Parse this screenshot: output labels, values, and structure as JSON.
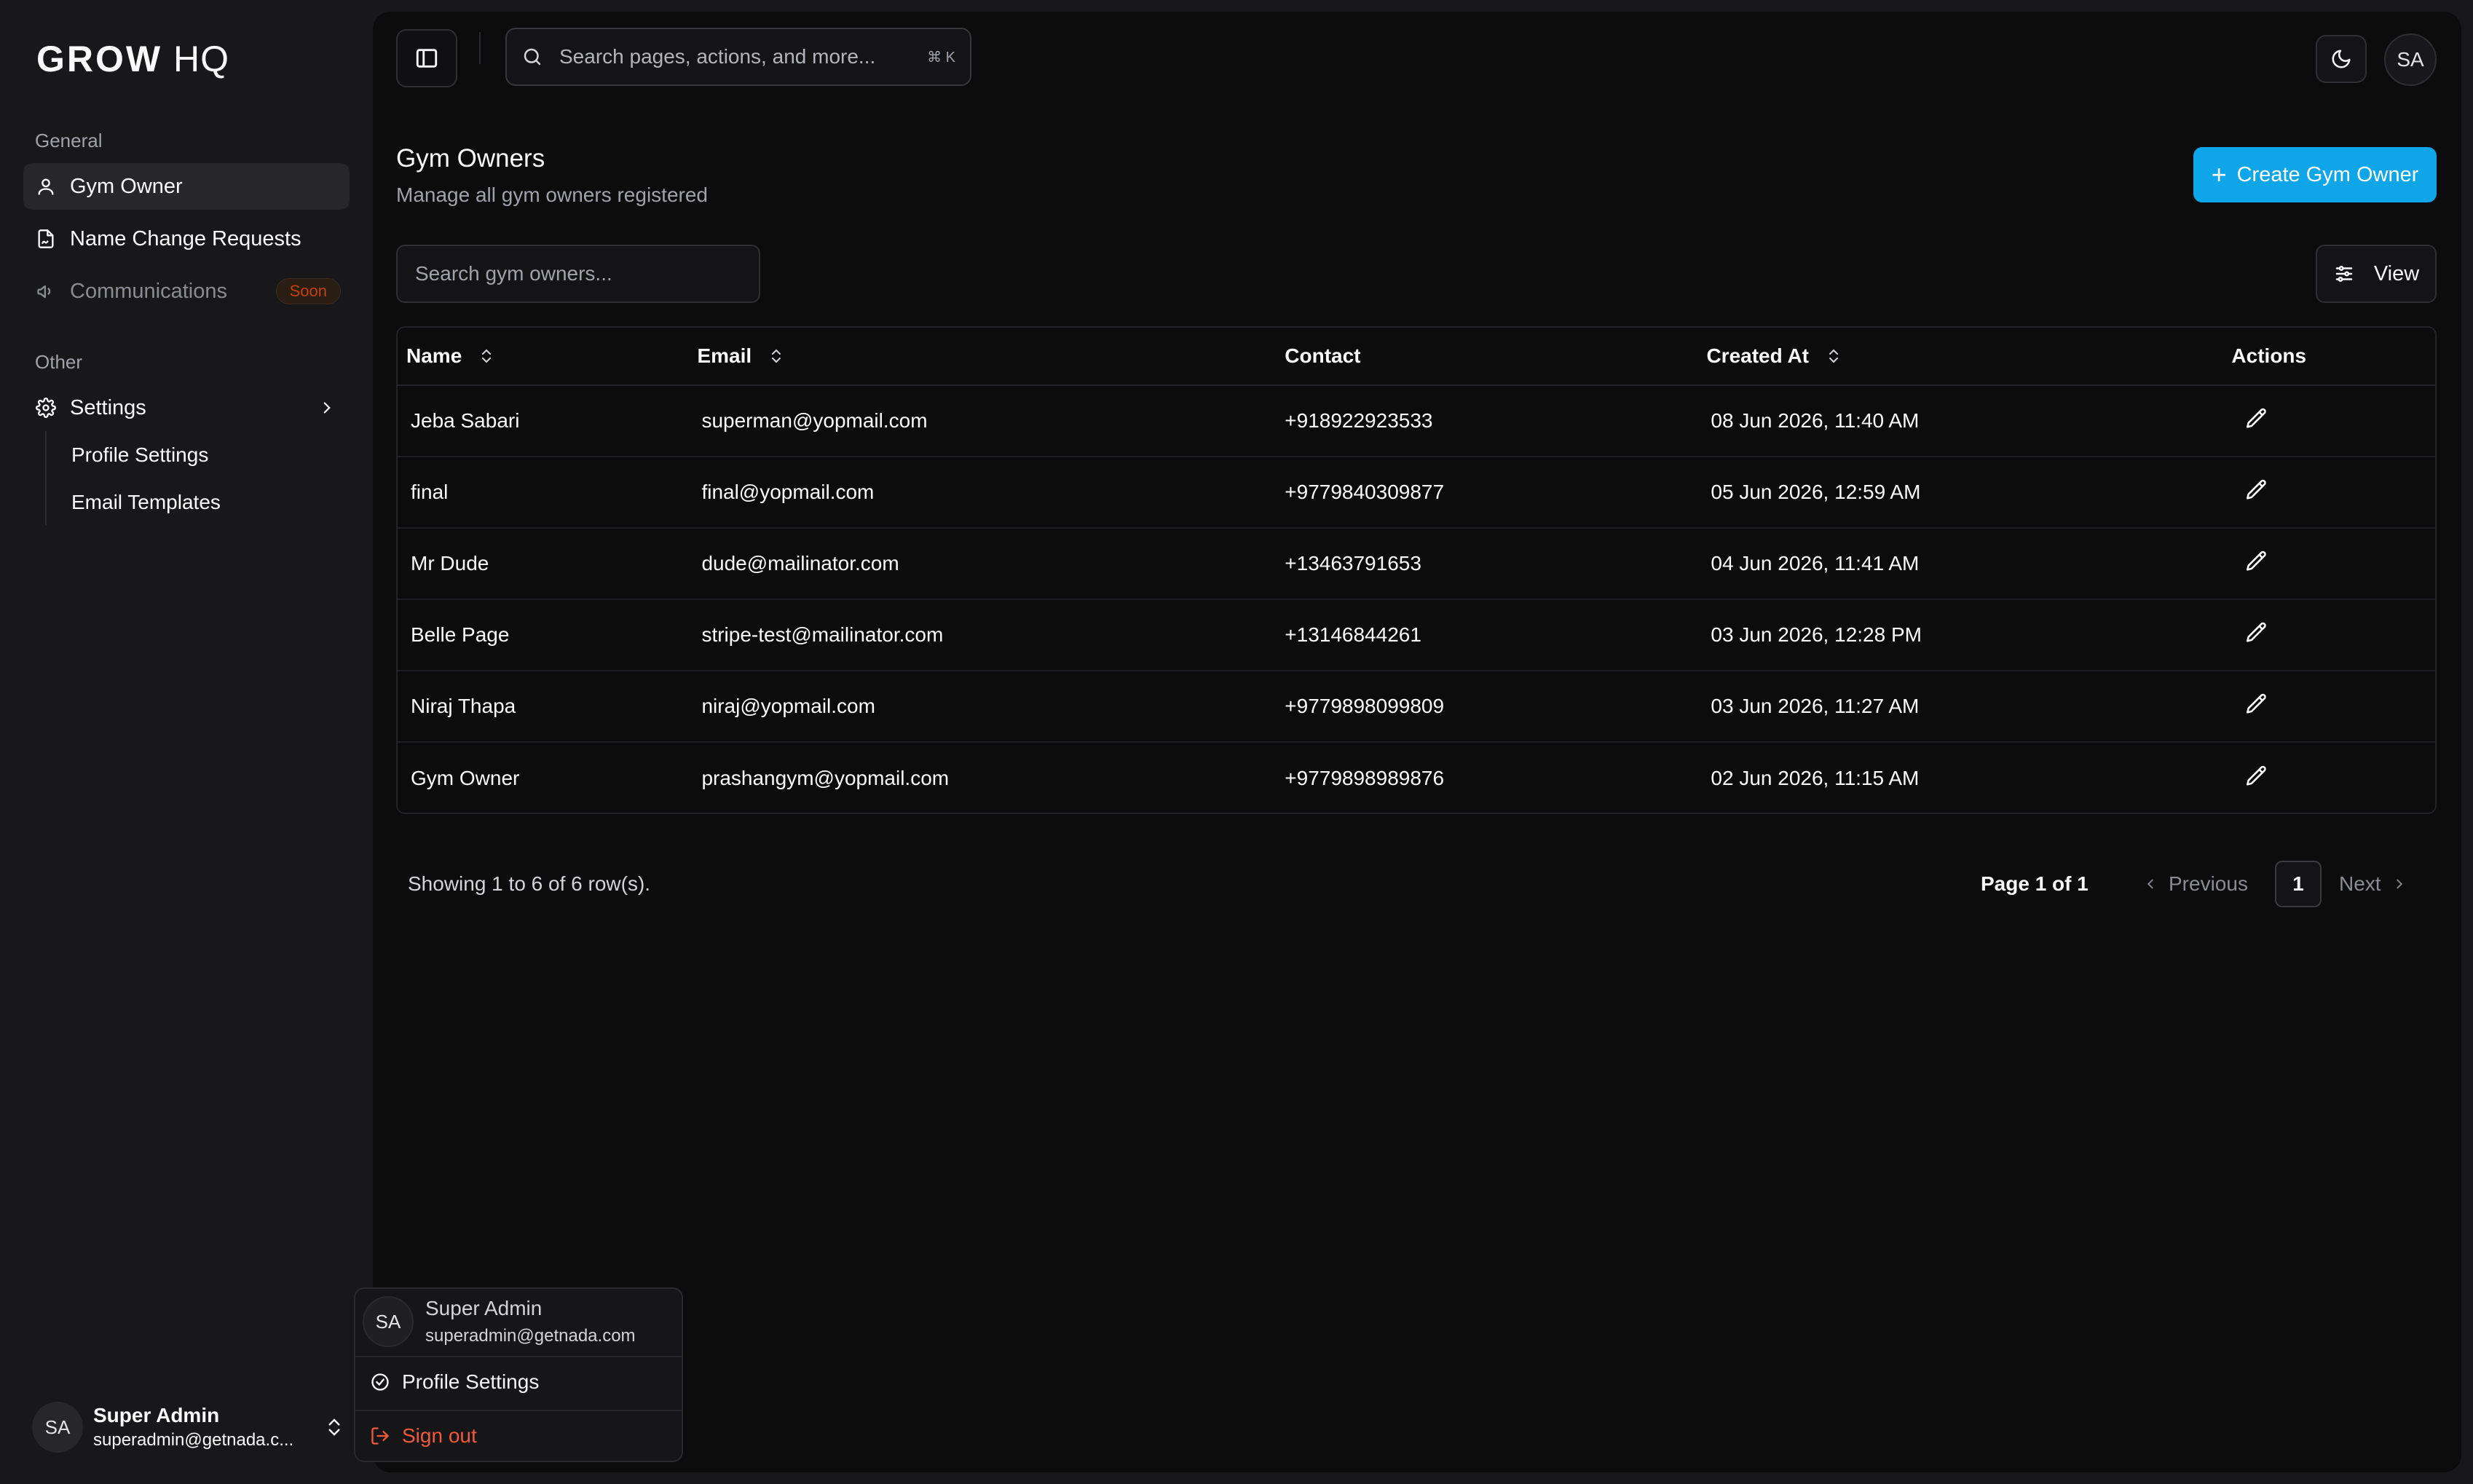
{
  "brand": {
    "bold": "GROW",
    "light": "HQ"
  },
  "sidebar": {
    "general_label": "General",
    "items": [
      {
        "label": "Gym Owner",
        "icon": "user-icon",
        "active": true
      },
      {
        "label": "Name Change Requests",
        "icon": "file-signature-icon"
      },
      {
        "label": "Communications",
        "icon": "megaphone-icon",
        "disabled": true,
        "badge": "Soon"
      }
    ],
    "other_label": "Other",
    "settings": {
      "label": "Settings",
      "icon": "gear-icon"
    },
    "settings_sub": [
      "Profile Settings",
      "Email Templates"
    ],
    "user": {
      "initials": "SA",
      "name": "Super Admin",
      "email": "superadmin@getnada.c..."
    }
  },
  "topbar": {
    "search_placeholder": "Search pages, actions, and more...",
    "shortcut": "⌘ K",
    "avatar_initials": "SA"
  },
  "page": {
    "title": "Gym Owners",
    "subtitle": "Manage all gym owners registered",
    "create_label": "Create Gym Owner",
    "search_placeholder": "Search gym owners...",
    "view_label": "View"
  },
  "table": {
    "columns": [
      "Name",
      "Email",
      "Contact",
      "Created At",
      "Actions"
    ],
    "rows": [
      {
        "name": "Jeba Sabari",
        "email": "superman@yopmail.com",
        "contact": "+918922923533",
        "created": "08 Jun 2026, 11:40 AM"
      },
      {
        "name": "final",
        "email": "final@yopmail.com",
        "contact": "+9779840309877",
        "created": "05 Jun 2026, 12:59 AM"
      },
      {
        "name": "Mr Dude",
        "email": "dude@mailinator.com",
        "contact": "+13463791653",
        "created": "04 Jun 2026, 11:41 AM"
      },
      {
        "name": "Belle Page",
        "email": "stripe-test@mailinator.com",
        "contact": "+13146844261",
        "created": "03 Jun 2026, 12:28 PM"
      },
      {
        "name": "Niraj Thapa",
        "email": "niraj@yopmail.com",
        "contact": "+9779898099809",
        "created": "03 Jun 2026, 11:27 AM"
      },
      {
        "name": "Gym Owner",
        "email": "prashangym@yopmail.com",
        "contact": "+9779898989876",
        "created": "02 Jun 2026, 11:15 AM"
      }
    ]
  },
  "pagination": {
    "showing": "Showing 1 to 6 of 6 row(s).",
    "page_info": "Page 1 of 1",
    "previous": "Previous",
    "current": "1",
    "next": "Next"
  },
  "popover": {
    "initials": "SA",
    "name": "Super Admin",
    "email": "superadmin@getnada.com",
    "profile_label": "Profile Settings",
    "signout_label": "Sign out"
  },
  "colors": {
    "accent": "#0ea5e9",
    "danger": "#f05a3a",
    "badge": "#c2410c"
  }
}
